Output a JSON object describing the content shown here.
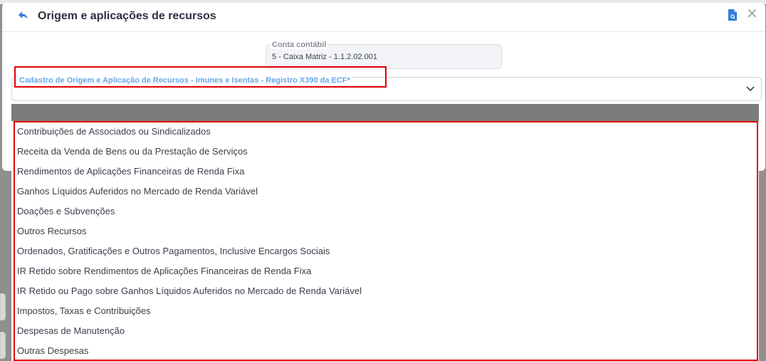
{
  "modal": {
    "title": "Origem e aplicações de recursos"
  },
  "conta_contabil": {
    "label": "Conta contábil",
    "value": "5 - Caixa Matriz  - 1.1.2.02.001"
  },
  "cadastro_select": {
    "label": "Cadastro de Origem e Aplicação de Recursos - Imunes e Isentas - Registro X390 da ECF*",
    "value": ""
  },
  "options": [
    "Contribuições de Associados ou Sindicalizados",
    "Receita da Venda de Bens ou da Prestação de Serviços",
    "Rendimentos de Aplicações Financeiras de Renda Fixa",
    "Ganhos Líquidos Auferidos no Mercado de Renda Variável",
    "Doações e Subvenções",
    "Outros Recursos",
    "Ordenados, Gratificações e Outros Pagamentos, Inclusive Encargos Sociais",
    "IR Retido sobre Rendimentos de Aplicações Financeiras de Renda Fixa",
    "IR Retido ou Pago sobre Ganhos Líquidos Auferidos no Mercado de Renda Variável",
    "Impostos, Taxas e Contribuições",
    "Despesas de Manutenção",
    "Outras Despesas"
  ],
  "colors": {
    "accent": "#2f7fd8",
    "label_blue": "#6aa6e8",
    "highlight_red": "#e00000",
    "dropdown_header": "#7b7b7b"
  },
  "icons": {
    "back": "back-arrow-icon",
    "document": "document-icon",
    "close": "close-icon",
    "chevron": "chevron-down-icon"
  }
}
